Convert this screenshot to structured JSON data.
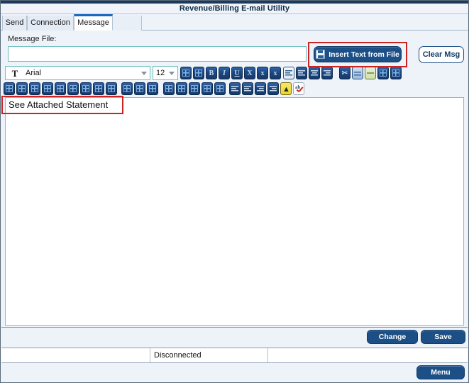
{
  "window": {
    "title": "Revenue/Billing E-mail Utility"
  },
  "tabs": [
    {
      "label": "Send",
      "active": false
    },
    {
      "label": "Connection",
      "active": false
    },
    {
      "label": "Message",
      "active": true
    }
  ],
  "message_file": {
    "label": "Message File:",
    "value": "",
    "placeholder": ""
  },
  "buttons": {
    "insert_text_from_file": "Insert Text from File",
    "clear_msg": "Clear Msg",
    "change": "Change",
    "save": "Save",
    "menu": "Menu"
  },
  "format_bar": {
    "font_icon": "font-icon",
    "font_family": "Arial",
    "font_size": "12",
    "row1_icons": [
      "font-color-icon",
      "highlight-color-icon",
      "bold-icon",
      "italic-icon",
      "underline-icon",
      "strikethrough-icon",
      "subscript-icon",
      "superscript-icon",
      "align-justify-icon",
      "align-left-icon",
      "align-center-icon",
      "align-right-icon",
      "cut-icon",
      "copy-icon",
      "paste-icon",
      "undo-icon",
      "redo-icon"
    ],
    "row2_icons": [
      "insert-table-icon",
      "table-properties-icon",
      "insert-row-above-icon",
      "insert-row-below-icon",
      "insert-column-left-icon",
      "insert-column-right-icon",
      "merge-cells-icon",
      "split-cells-icon",
      "delete-table-icon",
      "cell-border-icon",
      "grid-lines-icon",
      "cell-shading-icon",
      "row-height-icon",
      "column-width-icon",
      "table-align-icon",
      "cell-margin-icon",
      "table-style-icon",
      "bullet-list-icon",
      "numbered-list-icon",
      "indent-increase-icon",
      "indent-decrease-icon",
      "insert-image-icon",
      "spell-check-icon"
    ]
  },
  "editor": {
    "body_text": "See Attached Statement"
  },
  "status_bar": {
    "cell_left": "",
    "cell_center": "Disconnected",
    "cell_right": ""
  },
  "annotations": [
    {
      "name": "insert-text-from-file-highlight",
      "color": "#cc2222"
    },
    {
      "name": "message-body-highlight",
      "color": "#cc2222"
    }
  ],
  "colors": {
    "title_bar_accent": "#1b3a5c",
    "active_tab_accent": "#1769c0",
    "button_blue": "#1b4f86",
    "input_border_teal": "#6fc0bd",
    "annotation_red": "#cc2222",
    "panel_bg": "#eef3fa"
  }
}
